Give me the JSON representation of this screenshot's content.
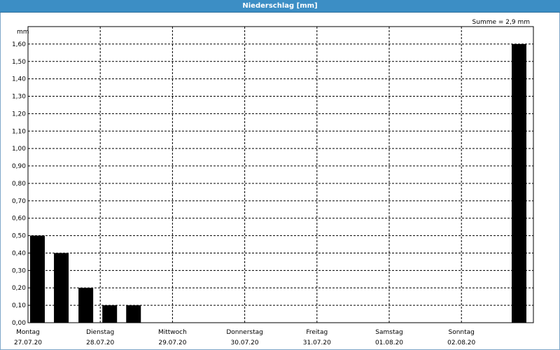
{
  "window": {
    "title": "Niederschlag [mm]"
  },
  "summary": "Summe = 2,9 mm",
  "colors": {
    "titlebar": "#3c8ec5",
    "bar": "#000000",
    "grid": "#000000"
  },
  "chart_data": {
    "type": "bar",
    "title": "Niederschlag [mm]",
    "ylabel": "mm",
    "ylim": [
      0,
      1.7
    ],
    "yticks": [
      "0,00",
      "0,10",
      "0,20",
      "0,30",
      "0,40",
      "0,50",
      "0,60",
      "0,70",
      "0,80",
      "0,90",
      "1,00",
      "1,10",
      "1,20",
      "1,30",
      "1,40",
      "1,50",
      "1,60"
    ],
    "xticks": [
      {
        "day": "Montag",
        "date": "27.07.20"
      },
      {
        "day": "Dienstag",
        "date": "28.07.20"
      },
      {
        "day": "Mittwoch",
        "date": "29.07.20"
      },
      {
        "day": "Donnerstag",
        "date": "30.07.20"
      },
      {
        "day": "Freitag",
        "date": "31.07.20"
      },
      {
        "day": "Samstag",
        "date": "01.08.20"
      },
      {
        "day": "Sonntag",
        "date": "02.08.20"
      }
    ],
    "bars": [
      {
        "day_offset": 0.0,
        "value": 0.5
      },
      {
        "day_offset": 0.33,
        "value": 0.4
      },
      {
        "day_offset": 0.67,
        "value": 0.2
      },
      {
        "day_offset": 1.0,
        "value": 0.1
      },
      {
        "day_offset": 1.33,
        "value": 0.1
      },
      {
        "day_offset": 6.92,
        "value": 1.6
      }
    ],
    "summary": "Summe = 2,9 mm",
    "grid": true
  }
}
